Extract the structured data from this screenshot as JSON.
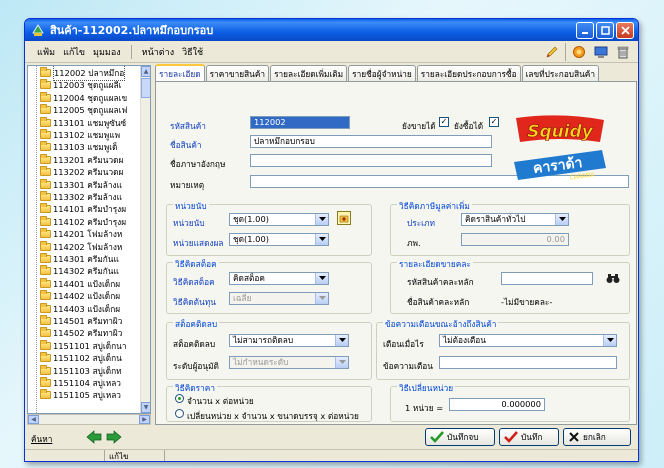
{
  "window": {
    "title": "สินค้า-112002.ปลาหมึกอบกรอบ"
  },
  "menu": {
    "items": [
      "แฟ้ม",
      "แก้ไข",
      "มุมมอง",
      "หน้าต่าง",
      "วิธีใช้"
    ]
  },
  "tree": {
    "items": [
      "112002 ปลาหมึกอ",
      "112003 ชุดถูแผลีเ",
      "112004 ชุดถูแผลเข",
      "112005 ชุดถูแผลเฟ",
      "113101 แชมพูซันซ์",
      "113102 แชมพูแพ",
      "113103 แชมพูเด็",
      "113201 ครีมนวดผ",
      "113202 ครีมนวดผ",
      "113301 ครีมล้างแ",
      "113302 ครีมล้างแ",
      "114101 ครีมบำรุงผ",
      "114102 ครีมบำรุงผ",
      "114201 โฟมล้างห",
      "114202 โฟมล้างห",
      "114301 ครีมกันแ",
      "114302 ครีมกันแ",
      "114401 แป้งเด็กผ",
      "114402 แป้งเด็กผ",
      "114403 แป้งเด็กผ",
      "114501 ครีมทาผิว",
      "114502 ครีมทาผิว",
      "1151101 สบู่เด็กนา",
      "1151102 สบู่เด็กน",
      "1151103 สบู่เด็กท",
      "1151104 สบู่เหลว",
      "1151105 สบู่เหลว"
    ]
  },
  "tabs": [
    "รายละเอียด",
    "ราคาขายสินค้า",
    "รายละเอียดเพิ่มเติม",
    "รายชื่อผู้จำหน่าย",
    "รายละเอียดประกอบการซื้อ",
    "เลขที่ประกอบสินค้า"
  ],
  "detail": {
    "code_label": "รหัสสินค้า",
    "code_value": "112002",
    "name_label": "ชื่อสินค้า",
    "name_value": "ปลาหมึกอบกรอบ",
    "eng_label": "ชื่อภาษาอังกฤษ",
    "eng_value": "",
    "note_label": "หมายเหตุ",
    "note_value": "",
    "can_sell_label": "ยังขายได้",
    "can_buy_label": "ยังซื้อได้",
    "can_sell": "✓",
    "can_buy": "✓"
  },
  "unit_group": {
    "title": "หน่วยนับ",
    "unit_label": "หน่วยนับ",
    "unit_value": "ชุด(1.00)",
    "display_label": "หน่วยแสดงผล",
    "display_value": "ชุด(1.00)"
  },
  "vat_group": {
    "title": "วิธีคิดภาษีมูลค่าเพิ่ม",
    "type_label": "ประเภท",
    "type_value": "คิดราสินค้าทั่วไป",
    "rate_label": "ภพ.",
    "rate_value": "0.00"
  },
  "stock_group": {
    "title": "วิธีคิดสต็อค",
    "method_label": "วิธีคิดสต็อค",
    "method_value": "คิดสต็อค",
    "cost_label": "วิธีคิดต้นทุน",
    "cost_value": "เฉลี่ย"
  },
  "size_group": {
    "title": "รายละเอียดขายคละ",
    "main_label": "รหัสสินค้าคละหลัก",
    "main_value": "",
    "name_label": "ชื่อสินค้าคละหลัก",
    "name_value": "-ไม่มีขายคละ-"
  },
  "negstock_group": {
    "title": "สต็อคติดลบ",
    "neg_label": "สต็อคติดลบ",
    "neg_value": "ไม่สามารถติดลบ",
    "approve_label": "ระดับผู้อนุมัติ",
    "approve_value": "ไม่กำหนดระดับ"
  },
  "warn_group": {
    "title": "ข้อความเตือนขณะอ้างถึงสินค้า",
    "when_label": "เตือนเมื่อไร",
    "when_value": "ไม่ต้องเตือน",
    "msg_label": "ข้อความเตือน",
    "msg_value": ""
  },
  "price_group": {
    "title": "วิธีคิดราคา",
    "opt1": "จำนวน x ต่อหน่วย",
    "opt2": "เปลี่ยนหน่วย x จำนวน x ขนาดบรรจุ x ต่อหน่วย"
  },
  "convert_group": {
    "title": "วิธีเปลี่ยนหน่วย",
    "label": "1 หน่วย =",
    "value": "0.000000"
  },
  "logo": {
    "top": "Squidy",
    "bottom": "คาราด้า",
    "sub": "CARADA"
  },
  "bottom": {
    "search": "ค้นหา",
    "save_close": "บันทึกจบ",
    "save": "บันทึก",
    "cancel": "ยกเลิก"
  },
  "status": {
    "mode": "แก้ไข"
  }
}
